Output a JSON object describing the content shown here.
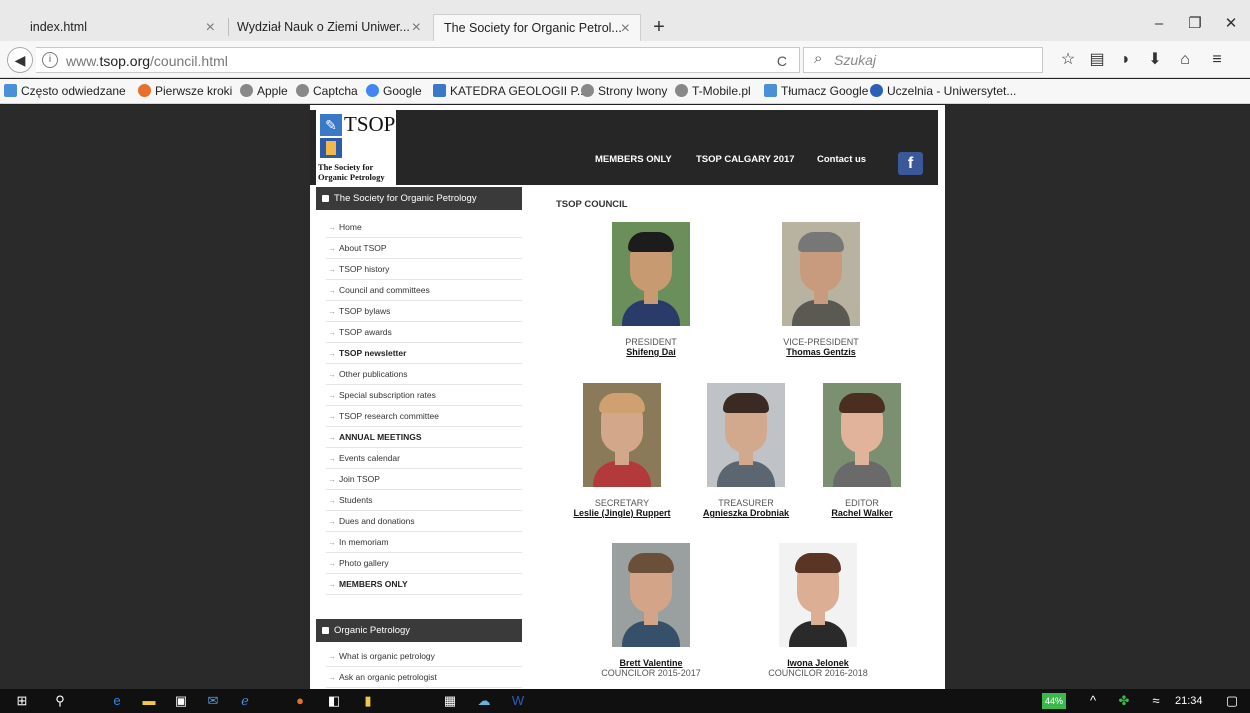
{
  "browser": {
    "tabs": [
      {
        "title": "index.html",
        "close": "×"
      },
      {
        "title": "Wydział Nauk o Ziemi Uniwer...",
        "close": "×"
      },
      {
        "title": "The Society for Organic Petrol...",
        "close": "×"
      }
    ],
    "new_tab": "+",
    "window": {
      "minimize": "–",
      "restore": "❐",
      "close": "✕"
    },
    "back": "◀",
    "info": "i",
    "url_prefix": "www.",
    "url_domain": "tsop.org",
    "url_path": "/council.html",
    "reload": "C",
    "search_placeholder": "Szukaj",
    "toolbar_icons": [
      "star-icon",
      "library-icon",
      "pocket-icon",
      "download-icon",
      "home-icon",
      "menu-icon"
    ],
    "bookmarks": [
      {
        "label": "Często odwiedzane",
        "color": "#4a90d9"
      },
      {
        "label": "Pierwsze kroki",
        "color": "#e8702a"
      },
      {
        "label": "Apple",
        "color": "#777777"
      },
      {
        "label": "Captcha",
        "color": "#777777"
      },
      {
        "label": "Google",
        "color": "#4285f4"
      },
      {
        "label": "KATEDRA GEOLOGII P...",
        "color": "#3a78c8"
      },
      {
        "label": "Strony Iwony",
        "color": "#777777"
      },
      {
        "label": "T-Mobile.pl",
        "color": "#777777"
      },
      {
        "label": "Tłumacz Google",
        "color": "#4a90d9"
      },
      {
        "label": "Uczelnia - Uniwersytet...",
        "color": "#2b5fb8"
      }
    ]
  },
  "site": {
    "logo_name": "TSOP",
    "logo_sub_line1": "The Society for",
    "logo_sub_line2": "Organic Petrology",
    "nav": [
      "MEMBERS ONLY",
      "TSOP CALGARY 2017",
      "Contact us"
    ],
    "facebook": "f",
    "sidebar": {
      "section1_title": "The Society for Organic Petrology",
      "items": [
        {
          "label": "Home",
          "bold": false
        },
        {
          "label": "About TSOP",
          "bold": false
        },
        {
          "label": "TSOP history",
          "bold": false
        },
        {
          "label": "Council and committees",
          "bold": false
        },
        {
          "label": "TSOP bylaws",
          "bold": false
        },
        {
          "label": "TSOP awards",
          "bold": false
        },
        {
          "label": "TSOP newsletter",
          "bold": true
        },
        {
          "label": "Other publications",
          "bold": false
        },
        {
          "label": "Special subscription rates",
          "bold": false
        },
        {
          "label": "TSOP research committee",
          "bold": false
        },
        {
          "label": "ANNUAL MEETINGS",
          "bold": true
        },
        {
          "label": "Events calendar",
          "bold": false
        },
        {
          "label": "Join TSOP",
          "bold": false
        },
        {
          "label": "Students",
          "bold": false
        },
        {
          "label": "Dues and donations",
          "bold": false
        },
        {
          "label": "In memoriam",
          "bold": false
        },
        {
          "label": "Photo gallery",
          "bold": false
        },
        {
          "label": "MEMBERS ONLY",
          "bold": true
        }
      ],
      "section2_title": "Organic Petrology",
      "items2": [
        {
          "label": "What is organic petrology",
          "bold": false
        },
        {
          "label": "Ask an organic petrologist",
          "bold": false
        }
      ]
    },
    "council_title": "TSOP COUNCIL",
    "council": [
      {
        "role": "PRESIDENT",
        "name": "Shifeng Dai",
        "bg": "#6b8f5a",
        "skin": "#c89a72",
        "hair": "#1c1c1c",
        "shirt": "#2a3b6a"
      },
      {
        "role": "VICE-PRESIDENT",
        "name": "Thomas Gentzis",
        "bg": "#b8b2a0",
        "skin": "#c99b7e",
        "hair": "#777777",
        "shirt": "#5a5a52"
      },
      {
        "role": "SECRETARY",
        "name": "Leslie (Jingle) Ruppert",
        "bg": "#8a7a5a",
        "skin": "#d3a88a",
        "hair": "#cfa070",
        "shirt": "#b33a3a"
      },
      {
        "role": "TREASURER",
        "name": "Agnieszka Drobniak",
        "bg": "#bfc3c8",
        "skin": "#d2a98c",
        "hair": "#3a2a22",
        "shirt": "#5b6670"
      },
      {
        "role": "EDITOR",
        "name": "Rachel Walker",
        "bg": "#7a9070",
        "skin": "#e0b39a",
        "hair": "#4a2e20",
        "shirt": "#6a6a6a"
      },
      {
        "role": "COUNCILOR 2015-2017",
        "name": "Brett Valentine",
        "bg": "#9aa0a0",
        "skin": "#d4a488",
        "hair": "#6a5038",
        "shirt": "#36506a"
      },
      {
        "role": "COUNCILOR 2016-2018",
        "name": "Iwona Jelonek",
        "bg": "#f2f2f2",
        "skin": "#dcae94",
        "hair": "#5a3424",
        "shirt": "#2a2a2a"
      }
    ]
  },
  "taskbar": {
    "battery": "44%",
    "clock": "21:34",
    "chevron": "^",
    "wifi": "≈"
  }
}
